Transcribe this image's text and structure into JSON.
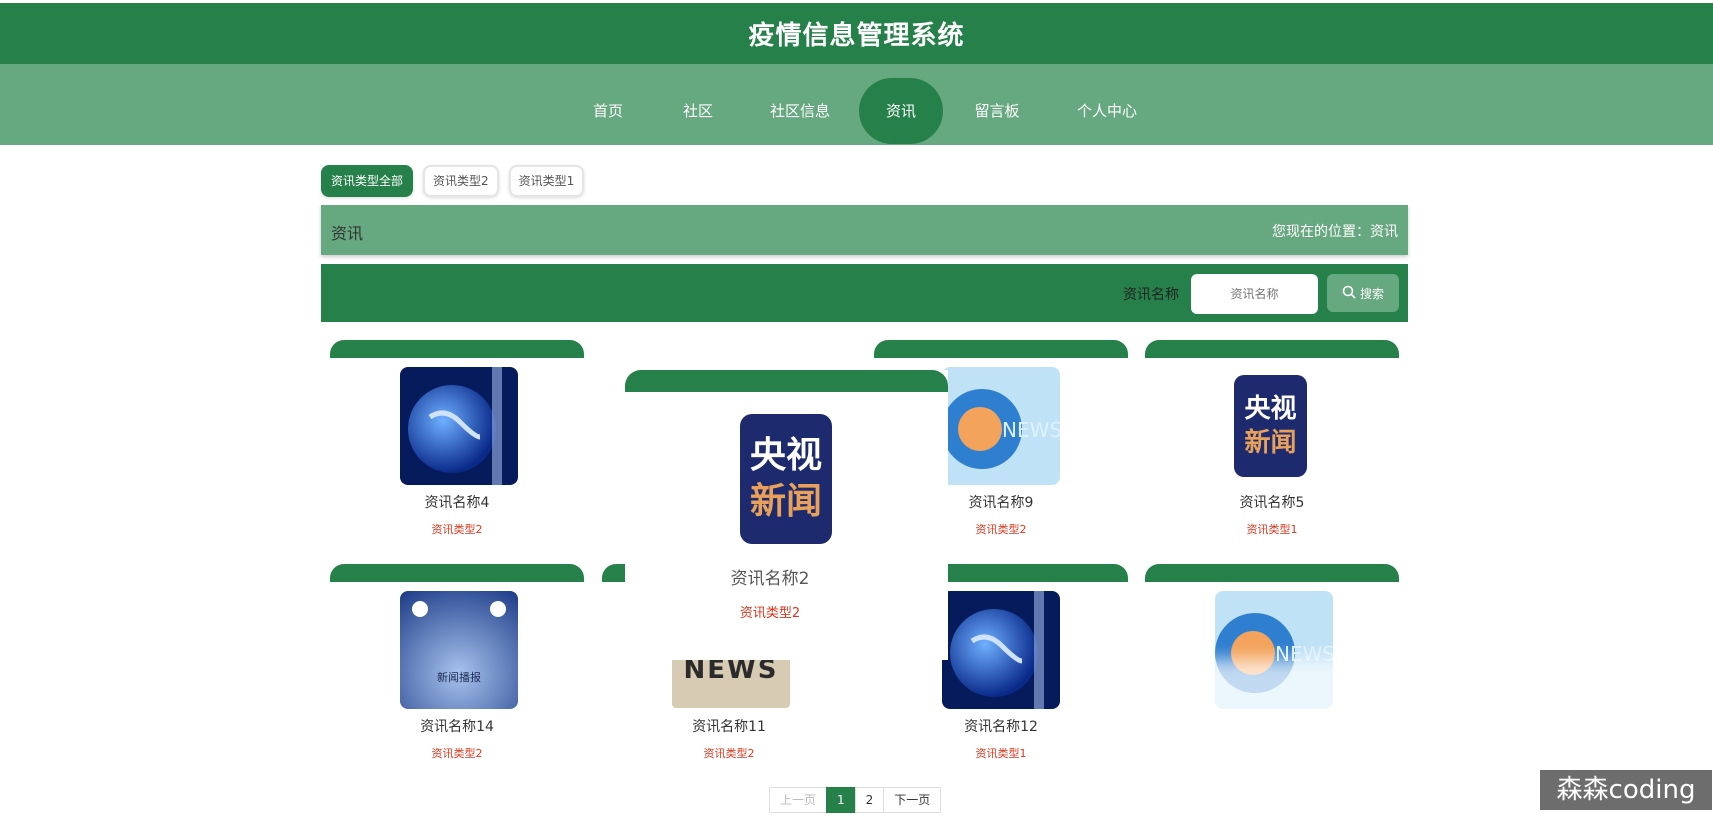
{
  "app": {
    "title": "疫情信息管理系统"
  },
  "nav": {
    "items": [
      {
        "label": "首页"
      },
      {
        "label": "社区"
      },
      {
        "label": "社区信息"
      },
      {
        "label": "资讯"
      },
      {
        "label": "留言板"
      },
      {
        "label": "个人中心"
      }
    ],
    "active": "资讯"
  },
  "filters": [
    {
      "label": "资讯类型全部",
      "active": true
    },
    {
      "label": "资讯类型2",
      "active": false
    },
    {
      "label": "资讯类型1",
      "active": false
    }
  ],
  "crumb": {
    "title": "资讯",
    "location": "您现在的位置：资讯"
  },
  "search": {
    "label": "资讯名称",
    "placeholder": "资讯名称",
    "button": "搜索"
  },
  "cards": [
    {
      "name": "资讯名称4",
      "type": "资讯类型2"
    },
    {
      "name": "资讯名称9",
      "type": "资讯类型2"
    },
    {
      "name": "资讯名称5",
      "type": "资讯类型1"
    },
    {
      "name": "资讯名称14",
      "type": "资讯类型2"
    },
    {
      "name": "资讯名称11",
      "type": "资讯类型2"
    },
    {
      "name": "资讯名称12",
      "type": "资讯类型1"
    }
  ],
  "popup": {
    "name": "资讯名称2",
    "type": "资讯类型2",
    "logo_line1": "央视",
    "logo_line2": "新闻"
  },
  "card_logo": {
    "line1": "央视",
    "line2": "新闻"
  },
  "card_image_text": {
    "stage": "新闻播报",
    "news": "NEWS"
  },
  "pager": {
    "prev": "上一页",
    "pages": [
      "1",
      "2"
    ],
    "current": "1",
    "next": "下一页"
  },
  "watermark": "森森coding"
}
